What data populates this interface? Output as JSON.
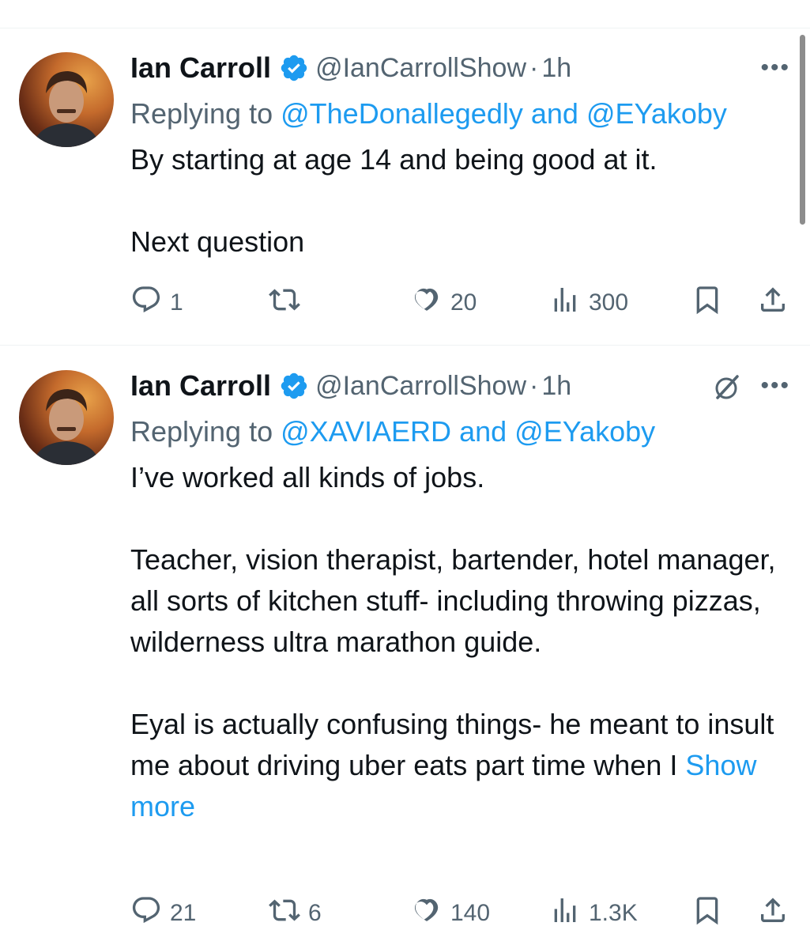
{
  "tweets": [
    {
      "author": {
        "name": "Ian Carroll",
        "handle": "@IanCarrollShow"
      },
      "separator": "·",
      "time": "1h",
      "more": "•••",
      "reply_prefix": "Replying to",
      "reply_to": [
        "@TheDonallegedly",
        "@EYakoby"
      ],
      "reply_joiner": "and",
      "body": [
        "By starting at age 14 and being good at it.",
        "Next question"
      ],
      "stats": {
        "replies": "1",
        "retweets": "",
        "likes": "20",
        "views": "300"
      }
    },
    {
      "author": {
        "name": "Ian Carroll",
        "handle": "@IanCarrollShow"
      },
      "separator": "·",
      "time": "1h",
      "more": "•••",
      "reply_prefix": "Replying to",
      "reply_to": [
        "@XAVIAERD",
        "@EYakoby"
      ],
      "reply_joiner": "and",
      "body": [
        "I’ve worked all kinds of jobs.",
        "Teacher, vision therapist, bartender, hotel manager, all sorts of kitchen stuff- including throwing pizzas, wilderness ultra marathon guide.",
        "Eyal is actually confusing things- he meant to insult me about driving uber eats part time when I"
      ],
      "show_more": "Show more",
      "stats": {
        "replies": "21",
        "retweets": "6",
        "likes": "140",
        "views": "1.3K"
      }
    }
  ],
  "icons": {
    "verified": "verified-badge-icon",
    "reply": "reply-icon",
    "retweet": "retweet-icon",
    "like": "heart-icon",
    "views": "views-icon",
    "bookmark": "bookmark-icon",
    "share": "share-icon",
    "grok": "grok-icon",
    "more": "more-icon"
  },
  "colors": {
    "accent": "#1d9bf0",
    "text": "#0f1419",
    "muted": "#536471",
    "divider": "#eff3f4"
  }
}
